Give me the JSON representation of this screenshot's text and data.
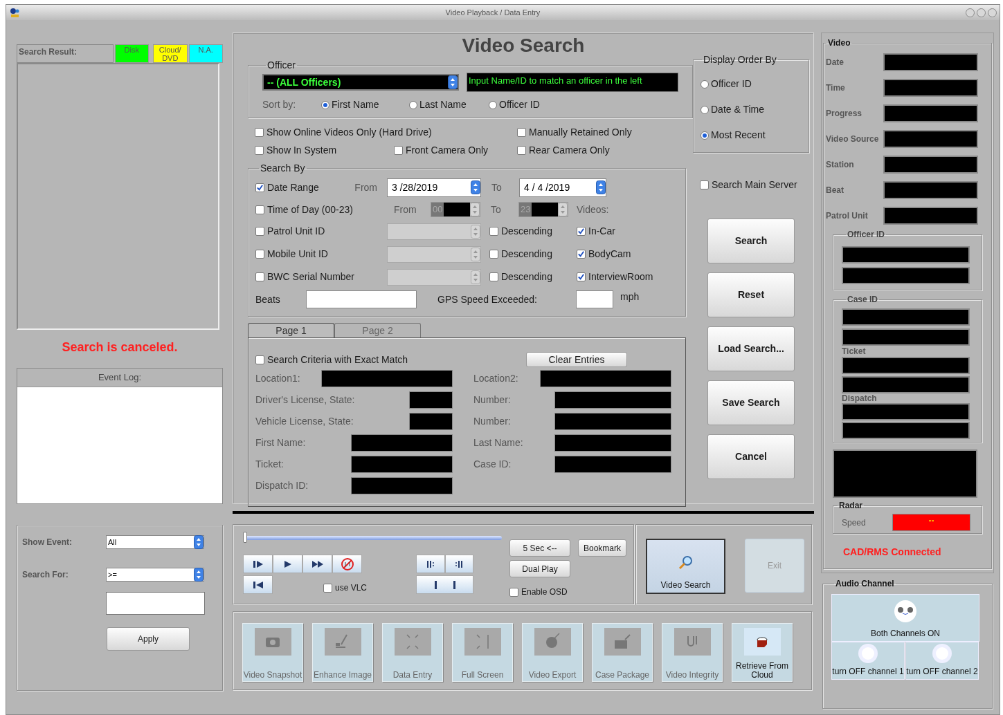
{
  "window": {
    "title": "Video Playback / Data Entry"
  },
  "search_result": {
    "label": "Search Result:",
    "legend": [
      {
        "label": "Disk",
        "color": "#00ff00"
      },
      {
        "label": "Cloud/ DVD",
        "color": "#ffff00"
      },
      {
        "label": "N.A.",
        "color": "#00ffff"
      }
    ],
    "status": "Search is canceled."
  },
  "event_log": {
    "title": "Event Log:"
  },
  "event_filter": {
    "show_event_label": "Show Event:",
    "show_event": "All",
    "search_for_label": "Search For:",
    "search_for": ">=",
    "apply": "Apply"
  },
  "heading": "Video Search",
  "officer": {
    "title": "Officer",
    "selected_officer": "-- (ALL Officers)",
    "hint": "Input Name/ID to match an officer in the left",
    "sort_label": "Sort by:",
    "sort_options": [
      {
        "label": "First Name",
        "selected": true
      },
      {
        "label": "Last Name",
        "selected": false
      },
      {
        "label": "Officer ID",
        "selected": false
      }
    ]
  },
  "filters": [
    {
      "label": "Show Online Videos Only (Hard Drive)",
      "checked": false
    },
    {
      "label": "Manually Retained Only",
      "checked": false
    },
    {
      "label": "Show In System",
      "checked": false
    },
    {
      "label": "Front Camera Only",
      "checked": false
    },
    {
      "label": "Rear Camera Only",
      "checked": false
    }
  ],
  "search_by": {
    "title": "Search By",
    "date_range": {
      "label": "Date Range",
      "checked": true,
      "from_label": "From",
      "from": "3 /28/2019",
      "to_label": "To",
      "to": "4 / 4 /2019"
    },
    "time_of_day": {
      "label": "Time of Day (00-23)",
      "checked": false,
      "from_label": "From",
      "from": "00",
      "to_label": "To",
      "to": "23"
    },
    "videos_label": "Videos:",
    "id_rows": [
      {
        "label": "Patrol Unit ID",
        "checked": false,
        "descending_label": "Descending",
        "descending": false,
        "video_type": "In-Car",
        "video_type_checked": true
      },
      {
        "label": "Mobile Unit ID",
        "checked": false,
        "descending_label": "Descending",
        "descending": false,
        "video_type": "BodyCam",
        "video_type_checked": true
      },
      {
        "label": "BWC Serial Number",
        "checked": false,
        "descending_label": "Descending",
        "descending": false,
        "video_type": "InterviewRoom",
        "video_type_checked": true
      }
    ],
    "beats_label": "Beats",
    "gps_label": "GPS Speed Exceeded:",
    "gps_unit": "mph"
  },
  "criteria": {
    "tabs": [
      {
        "label": "Page 1",
        "selected": true
      },
      {
        "label": "Page 2",
        "selected": false
      }
    ],
    "exact_match": {
      "label": "Search Criteria with Exact Match",
      "checked": false
    },
    "clear": "Clear Entries",
    "rows": [
      {
        "left": {
          "label": "Location1:",
          "kind": "wide"
        },
        "right": {
          "label": "Location2:",
          "kind": "wide"
        }
      },
      {
        "left": {
          "label": "Driver's License, State:",
          "kind": "short"
        },
        "right": {
          "label": "Number:",
          "kind": "medium"
        }
      },
      {
        "left": {
          "label": "Vehicle License, State:",
          "kind": "short"
        },
        "right": {
          "label": "Number:",
          "kind": "medium"
        }
      },
      {
        "left": {
          "label": "First Name:",
          "kind": "medium"
        },
        "right": {
          "label": "Last Name:",
          "kind": "medium"
        }
      },
      {
        "left": {
          "label": "Ticket:",
          "kind": "medium"
        },
        "right": {
          "label": "Case ID:",
          "kind": "medium"
        }
      },
      {
        "left": {
          "label": "Dispatch ID:",
          "kind": "medium"
        }
      }
    ]
  },
  "display_order": {
    "title": "Display Order By",
    "options": [
      {
        "label": "Officer ID",
        "selected": false
      },
      {
        "label": "Date & Time",
        "selected": false
      },
      {
        "label": "Most Recent",
        "selected": true
      }
    ]
  },
  "search_main_server": {
    "label": "Search Main Server",
    "checked": false
  },
  "actions": [
    "Search",
    "Reset",
    "Load Search...",
    "Save Search",
    "Cancel"
  ],
  "player": {
    "level": 0,
    "use_vlc": {
      "label": "use VLC",
      "checked": false
    },
    "skip": "5 Sec <--",
    "dual_play": "Dual Play",
    "bookmark": "Bookmark",
    "enable_osd": {
      "label": "Enable OSD",
      "checked": false
    }
  },
  "video_search_button": "Video Search",
  "exit": {
    "label": "Exit",
    "disabled": true
  },
  "tools": [
    {
      "label": "Video Snapshot",
      "disabled": true
    },
    {
      "label": "Enhance Image",
      "disabled": true
    },
    {
      "label": "Data Entry",
      "disabled": true
    },
    {
      "label": "Full Screen",
      "disabled": true
    },
    {
      "label": "Video Export",
      "disabled": true
    },
    {
      "label": "Case Package",
      "disabled": true
    },
    {
      "label": "Video Integrity",
      "disabled": true
    },
    {
      "label": "Retrieve From Cloud",
      "disabled": false
    }
  ],
  "video_info": {
    "title": "Video",
    "fields": [
      "Date",
      "Time",
      "Progress",
      "Video Source",
      "Station",
      "Beat",
      "Patrol Unit"
    ],
    "officer_id": "Officer ID",
    "case_id": "Case ID",
    "ticket": "Ticket",
    "dispatch": "Dispatch",
    "radar": {
      "title": "Radar",
      "speed_label": "Speed",
      "speed": "--"
    },
    "cad_status": "CAD/RMS Connected"
  },
  "audio": {
    "title": "Audio Channel",
    "both": "Both Channels ON",
    "channels": [
      "turn OFF channel 1",
      "turn OFF channel 2"
    ]
  }
}
